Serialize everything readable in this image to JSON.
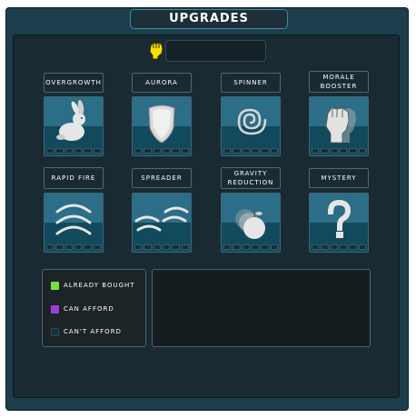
{
  "header": {
    "title": "UPGRADES"
  },
  "currency": {
    "icon": "fist-icon",
    "value": ""
  },
  "upgrades": [
    {
      "label": "OVERGROWTH",
      "icon": "rabbit-icon"
    },
    {
      "label": "AURORA",
      "icon": "shield-icon"
    },
    {
      "label": "SPINNER",
      "icon": "spiral-icon"
    },
    {
      "label": "MORALE BOOSTER",
      "icon": "fist-icon"
    },
    {
      "label": "RAPID FIRE",
      "icon": "arcs-icon"
    },
    {
      "label": "SPREADER",
      "icon": "spread-arcs-icon"
    },
    {
      "label": "GRAVITY REDUCTION",
      "icon": "apple-icon"
    },
    {
      "label": "MYSTERY",
      "icon": "question-mark-icon"
    }
  ],
  "legend": [
    {
      "label": "ALREADY BOUGHT",
      "color": "#7be03a"
    },
    {
      "label": "CAN AFFORD",
      "color": "#9b3fd8"
    },
    {
      "label": "CAN'T AFFORD",
      "color": "#14323d"
    }
  ],
  "description": {
    "text": ""
  },
  "colors": {
    "frame": "#1c3e4c",
    "panel": "#1a2a33",
    "card_top": "#2c6d87",
    "card_bottom": "#12495d",
    "accent": "#3f8aa6"
  }
}
